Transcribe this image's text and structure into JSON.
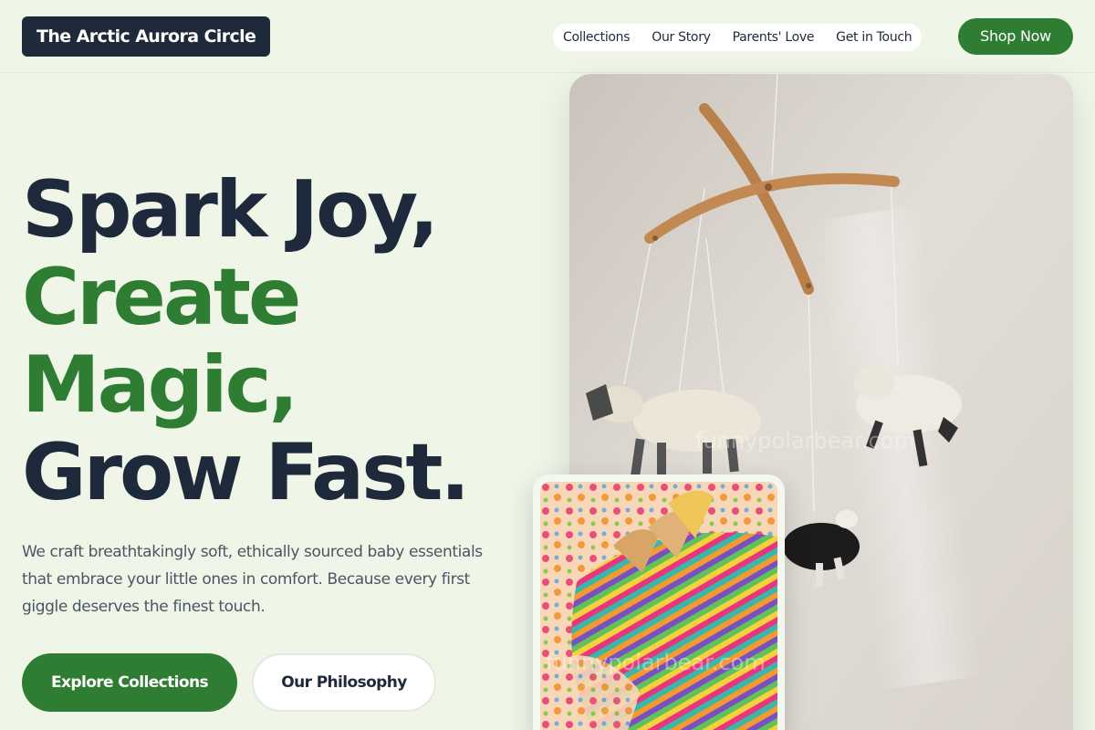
{
  "brand": {
    "name": "The Arctic Aurora Circle"
  },
  "nav": {
    "items": [
      {
        "label": "Collections"
      },
      {
        "label": "Our Story"
      },
      {
        "label": "Parents' Love"
      },
      {
        "label": "Get in Touch"
      }
    ],
    "cta_label": "Shop Now"
  },
  "hero": {
    "headline": [
      {
        "text": "Spark Joy,"
      },
      {
        "text": "Create"
      },
      {
        "text": "Magic,"
      },
      {
        "text": "Grow Fast."
      }
    ],
    "description": "We craft breathtakingly soft, ethically sourced baby essentials that embrace your little ones in comfort. Because every first giggle deserves the finest touch.",
    "primary_button": "Explore Collections",
    "secondary_button": "Our Philosophy"
  },
  "images": {
    "main": {
      "watermark": "funnypolarbear.com"
    },
    "secondary": {
      "watermark": "funnypolarbear.com"
    }
  },
  "colors": {
    "background": "#eff6e7",
    "navy": "#1e293b",
    "accent_green": "#2e7d32",
    "muted_text": "#4b5563"
  }
}
